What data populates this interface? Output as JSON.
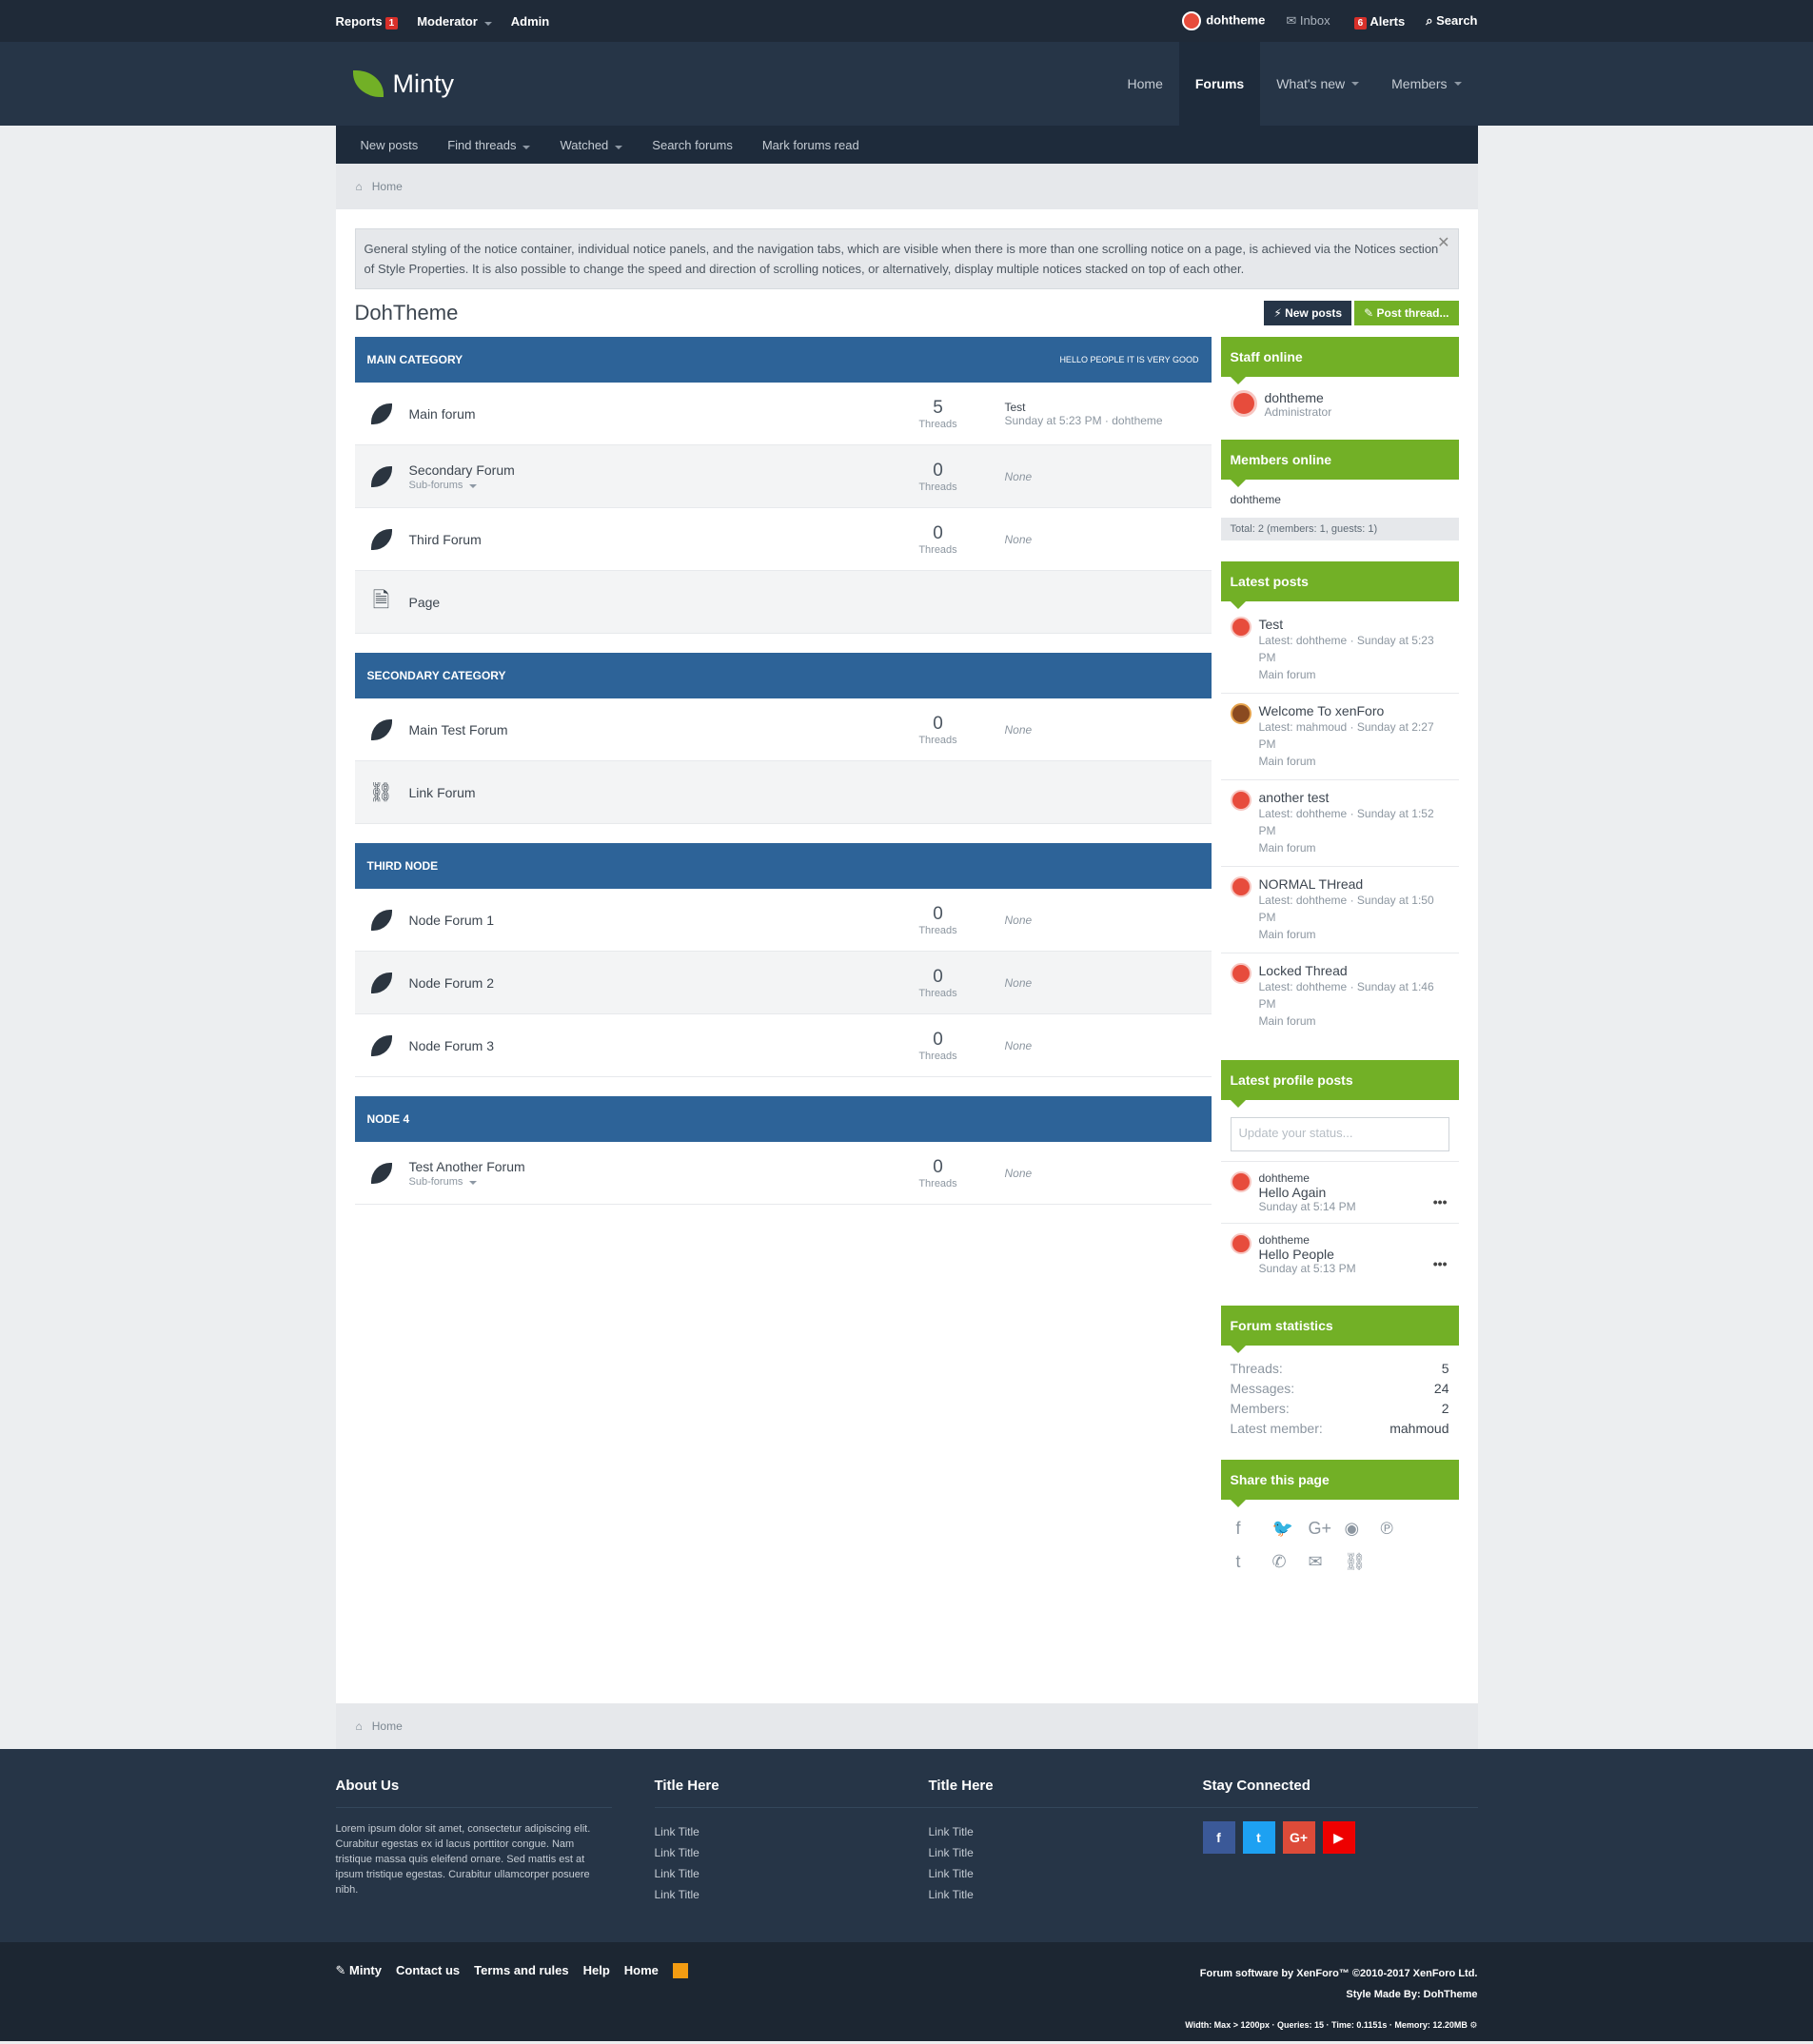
{
  "topbar": {
    "reports": "Reports",
    "reports_count": "1",
    "moderator": "Moderator",
    "admin": "Admin",
    "user": "dohtheme",
    "inbox": "Inbox",
    "alerts": "Alerts",
    "alerts_count": "6",
    "search": "Search"
  },
  "logo": "Minty",
  "mainnav": [
    "Home",
    "Forums",
    "What's new",
    "Members"
  ],
  "subnav": [
    "New posts",
    "Find threads",
    "Watched",
    "Search forums",
    "Mark forums read"
  ],
  "breadcrumb": "Home",
  "notice": "General styling of the notice container, individual notice panels, and the navigation tabs, which are visible when there is more than one scrolling notice on a page, is achieved via the Notices section of Style Properties. It is also possible to change the speed and direction of scrolling notices, or alternatively, display multiple notices stacked on top of each other.",
  "page_title": "DohTheme",
  "buttons": {
    "new_posts": "New posts",
    "post_thread": "Post thread..."
  },
  "categories": [
    {
      "title": "MAIN CATEGORY",
      "desc": "HELLO PEOPLE IT IS VERY GOOD",
      "nodes": [
        {
          "name": "Main forum",
          "count": "5",
          "label": "Threads",
          "last_title": "Test",
          "last_meta": "Sunday at 5:23 PM · dohtheme"
        },
        {
          "name": "Secondary Forum",
          "sub": "Sub-forums",
          "count": "0",
          "label": "Threads",
          "last": "None"
        },
        {
          "name": "Third Forum",
          "count": "0",
          "label": "Threads",
          "last": "None"
        },
        {
          "name": "Page"
        }
      ]
    },
    {
      "title": "SECONDARY CATEGORY",
      "nodes": [
        {
          "name": "Main Test Forum",
          "count": "0",
          "label": "Threads",
          "last": "None"
        },
        {
          "name": "Link Forum"
        }
      ]
    },
    {
      "title": "THIRD NODE",
      "nodes": [
        {
          "name": "Node Forum 1",
          "count": "0",
          "label": "Threads",
          "last": "None"
        },
        {
          "name": "Node Forum 2",
          "count": "0",
          "label": "Threads",
          "last": "None"
        },
        {
          "name": "Node Forum 3",
          "count": "0",
          "label": "Threads",
          "last": "None"
        }
      ]
    },
    {
      "title": "NODE 4",
      "nodes": [
        {
          "name": "Test Another Forum",
          "sub": "Sub-forums",
          "count": "0",
          "label": "Threads",
          "last": "None"
        }
      ]
    }
  ],
  "sidebar": {
    "staff_title": "Staff online",
    "staff": {
      "name": "dohtheme",
      "role": "Administrator"
    },
    "members_title": "Members online",
    "members": "dohtheme",
    "members_total": "Total: 2 (members: 1, guests: 1)",
    "latest_title": "Latest posts",
    "latest": [
      {
        "title": "Test",
        "meta": "Latest: dohtheme · Sunday at 5:23 PM",
        "forum": "Main forum"
      },
      {
        "title": "Welcome To xenForo",
        "meta": "Latest: mahmoud · Sunday at 2:27 PM",
        "forum": "Main forum"
      },
      {
        "title": "another test",
        "meta": "Latest: dohtheme · Sunday at 1:52 PM",
        "forum": "Main forum"
      },
      {
        "title": "NORMAL THread",
        "meta": "Latest: dohtheme · Sunday at 1:50 PM",
        "forum": "Main forum"
      },
      {
        "title": "Locked Thread",
        "meta": "Latest: dohtheme · Sunday at 1:46 PM",
        "forum": "Main forum"
      }
    ],
    "profile_title": "Latest profile posts",
    "status_placeholder": "Update your status...",
    "profile_posts": [
      {
        "user": "dohtheme",
        "text": "Hello Again",
        "when": "Sunday at 5:14 PM"
      },
      {
        "user": "dohtheme",
        "text": "Hello People",
        "when": "Sunday at 5:13 PM"
      }
    ],
    "stats_title": "Forum statistics",
    "stats": [
      {
        "k": "Threads:",
        "v": "5"
      },
      {
        "k": "Messages:",
        "v": "24"
      },
      {
        "k": "Members:",
        "v": "2"
      },
      {
        "k": "Latest member:",
        "v": "mahmoud"
      }
    ],
    "share_title": "Share this page"
  },
  "footer": {
    "about_title": "About Us",
    "about_text": "Lorem ipsum dolor sit amet, consectetur adipiscing elit. Curabitur egestas ex id lacus porttitor congue. Nam tristique massa quis eleifend ornare. Sed mattis est at ipsum tristique egestas. Curabitur ullamcorper posuere nibh.",
    "col2_title": "Title Here",
    "col3_title": "Title Here",
    "link": "Link Title",
    "stay_title": "Stay Connected",
    "social": [
      "f",
      "t",
      "G+",
      "▶"
    ]
  },
  "bottom": {
    "links": [
      "Minty",
      "Contact us",
      "Terms and rules",
      "Help",
      "Home"
    ],
    "copyright": "Forum software by XenForo™ ©2010-2017 XenForo Ltd.",
    "style": "Style Made By: DohTheme",
    "debug": "Width: Max > 1200px · Queries: 15 · Time: 0.1151s · Memory: 12.20MB"
  },
  "colors": {
    "accent": "#72b026",
    "category": "#2d6398",
    "header": "#263547",
    "topbar": "#1f2a38"
  }
}
